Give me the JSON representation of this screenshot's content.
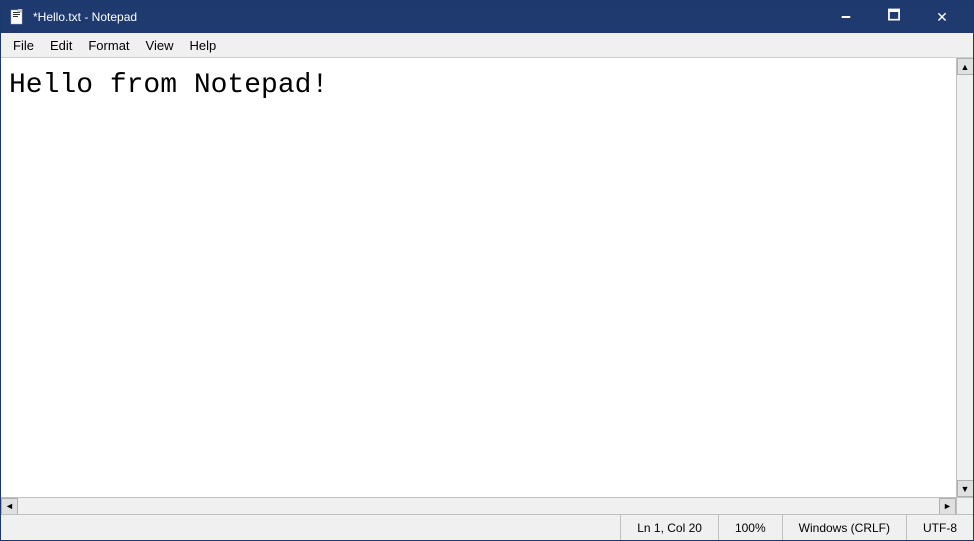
{
  "window": {
    "title": "*Hello.txt - Notepad",
    "icon": "notepad-icon"
  },
  "titlebar": {
    "minimize_label": "🗕",
    "maximize_label": "🗖",
    "close_label": "✕"
  },
  "menubar": {
    "items": [
      {
        "label": "File",
        "id": "file"
      },
      {
        "label": "Edit",
        "id": "edit"
      },
      {
        "label": "Format",
        "id": "format"
      },
      {
        "label": "View",
        "id": "view"
      },
      {
        "label": "Help",
        "id": "help"
      }
    ]
  },
  "editor": {
    "content": "Hello from Notepad!"
  },
  "statusbar": {
    "position": "Ln 1, Col 20",
    "zoom": "100%",
    "line_ending": "Windows (CRLF)",
    "encoding": "UTF-8"
  },
  "scrollbar": {
    "up_arrow": "▲",
    "down_arrow": "▼",
    "left_arrow": "◄",
    "right_arrow": "►"
  }
}
